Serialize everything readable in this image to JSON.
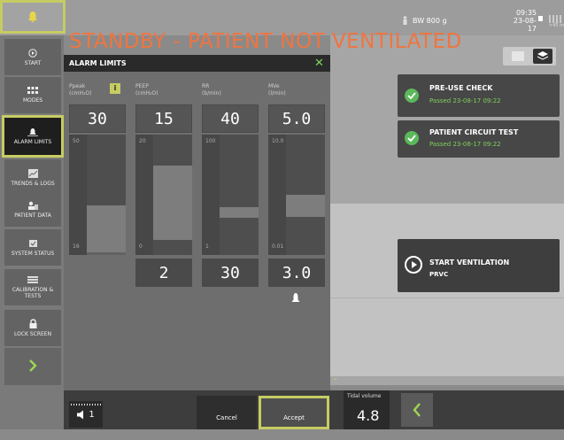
{
  "header": {
    "title": "STANDBY - PATIENT NOT VENTILATED",
    "bw": "BW 800 g",
    "time": "09:35",
    "date": "23-08-17",
    "battery_sub": ">45 m"
  },
  "sidebar": {
    "items": [
      {
        "label": "START",
        "icon": "play-circle-icon"
      },
      {
        "label": "MODES",
        "icon": "grid-icon"
      },
      {
        "label": "ALARM LIMITS",
        "icon": "alarm-bell-icon"
      },
      {
        "label": "TRENDS & LOGS",
        "icon": "trends-icon"
      },
      {
        "label": "PATIENT DATA",
        "icon": "patient-icon"
      },
      {
        "label": "SYSTEM STATUS",
        "icon": "system-status-icon"
      },
      {
        "label": "CALIBRATION & TESTS",
        "icon": "calibration-icon"
      },
      {
        "label": "LOCK SCREEN",
        "icon": "lock-icon"
      }
    ]
  },
  "dialog": {
    "title": "ALARM LIMITS",
    "columns": [
      {
        "name": "Ppeak",
        "unit": "(cmH₂O)",
        "high": "30",
        "low": "",
        "scale_top": "50",
        "scale_bottom": "16"
      },
      {
        "name": "PEEP",
        "unit": "(cmH₂O)",
        "high": "15",
        "low": "2",
        "scale_top": "20",
        "scale_bottom": "0"
      },
      {
        "name": "RR",
        "unit": "(b/min)",
        "high": "40",
        "low": "30",
        "scale_top": "100",
        "scale_bottom": "1"
      },
      {
        "name": "MVe",
        "unit": "(l/min)",
        "high": "5.0",
        "low": "3.0",
        "scale_top": "10.0",
        "scale_bottom": "0.01"
      }
    ],
    "info_label": "i",
    "cancel_label": "Cancel",
    "accept_label": "Accept"
  },
  "cards": {
    "preuse_title": "PRE-USE CHECK",
    "preuse_status": "Passed 23-08-17 09:22",
    "circuit_title": "PATIENT CIRCUIT TEST",
    "circuit_status": "Passed 23-08-17 09:22",
    "start_title": "START VENTILATION",
    "start_mode": "PRVC"
  },
  "bottom": {
    "speaker_label": "1",
    "tidal_label": "Tidal volume",
    "tidal_value": "4.8"
  },
  "colors": {
    "accent": "#c6cc63",
    "title": "#f07540",
    "ok_green": "#5cb85c"
  }
}
